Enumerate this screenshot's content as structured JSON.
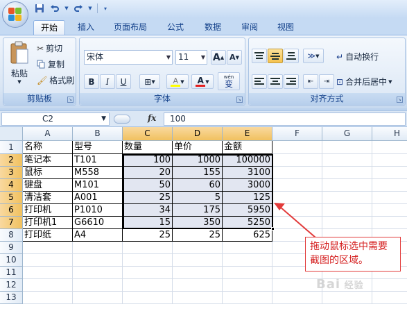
{
  "quick_access": {
    "icons": [
      "save-icon",
      "undo-icon",
      "redo-icon",
      "customize-icon"
    ]
  },
  "tabs": [
    {
      "label": "开始",
      "active": true
    },
    {
      "label": "插入"
    },
    {
      "label": "页面布局"
    },
    {
      "label": "公式"
    },
    {
      "label": "数据"
    },
    {
      "label": "审阅"
    },
    {
      "label": "视图"
    }
  ],
  "ribbon": {
    "clipboard": {
      "paste": "粘贴",
      "cut": "剪切",
      "copy": "复制",
      "format_painter": "格式刷",
      "label": "剪贴板"
    },
    "font": {
      "name": "宋体",
      "size": "11",
      "grow": "A",
      "shrink": "A",
      "bold": "B",
      "italic": "I",
      "underline": "U",
      "border": "⊞",
      "fill": "A",
      "color": "A",
      "wen": "wén",
      "wen_char": "变",
      "label": "字体"
    },
    "alignment": {
      "wrap": "自动换行",
      "merge": "合并后居中",
      "label": "对齐方式"
    }
  },
  "formula_bar": {
    "cell_ref": "C2",
    "fx": "fx",
    "value": "100"
  },
  "columns": [
    "A",
    "B",
    "C",
    "D",
    "E",
    "F",
    "G",
    "H"
  ],
  "rows": [
    "1",
    "2",
    "3",
    "4",
    "5",
    "6",
    "7",
    "8",
    "9",
    "10",
    "11",
    "12",
    "13"
  ],
  "table": {
    "headers": [
      "名称",
      "型号",
      "数量",
      "单价",
      "金额"
    ],
    "rows": [
      [
        "笔记本",
        "T101",
        "100",
        "1000",
        "100000"
      ],
      [
        "鼠标",
        "M558",
        "20",
        "155",
        "3100"
      ],
      [
        "键盘",
        "M101",
        "50",
        "60",
        "3000"
      ],
      [
        "清洁套",
        "A001",
        "25",
        "5",
        "125"
      ],
      [
        "打印机",
        "P1010",
        "34",
        "175",
        "5950"
      ],
      [
        "打印机1",
        "G6610",
        "15",
        "350",
        "5250"
      ],
      [
        "打印纸",
        "A4",
        "25",
        "25",
        "625"
      ]
    ]
  },
  "annotation": {
    "text": "拖动鼠标选中需要截图的区域。",
    "color": "#d52020"
  },
  "watermark": "Bai 经验",
  "colors": {
    "selection_header": "#f1c15f",
    "selection_fill": "#e2e6f1",
    "ribbon": "#dae6f4",
    "tab_text": "#15428b"
  }
}
